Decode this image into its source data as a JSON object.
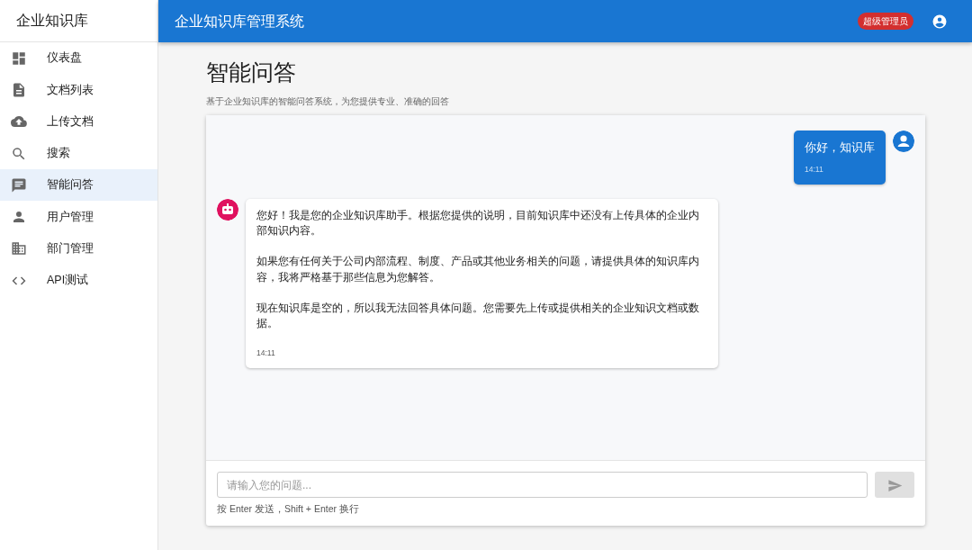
{
  "sidebar": {
    "title": "企业知识库",
    "items": [
      {
        "label": "仪表盘",
        "kind": "dashboard",
        "selected": false
      },
      {
        "label": "文档列表",
        "kind": "document",
        "selected": false
      },
      {
        "label": "上传文档",
        "kind": "upload",
        "selected": false
      },
      {
        "label": "搜索",
        "kind": "search",
        "selected": false
      },
      {
        "label": "智能问答",
        "kind": "chat",
        "selected": true
      },
      {
        "label": "用户管理",
        "kind": "person",
        "selected": false
      },
      {
        "label": "部门管理",
        "kind": "building",
        "selected": false
      },
      {
        "label": "API测试",
        "kind": "code",
        "selected": false
      }
    ]
  },
  "header": {
    "title": "企业知识库管理系统",
    "role_badge": "超级管理员"
  },
  "page": {
    "title": "智能问答",
    "subtitle": "基于企业知识库的智能问答系统，为您提供专业、准确的回答"
  },
  "messages": [
    {
      "kind": "user",
      "paragraphs": [
        "你好，知识库"
      ],
      "time": "14:11"
    },
    {
      "kind": "assistant",
      "paragraphs": [
        "您好！我是您的企业知识库助手。根据您提供的说明，目前知识库中还没有上传具体的企业内部知识内容。",
        "如果您有任何关于公司内部流程、制度、产品或其他业务相关的问题，请提供具体的知识库内容，我将严格基于那些信息为您解答。",
        "现在知识库是空的，所以我无法回答具体问题。您需要先上传或提供相关的企业知识文档或数据。"
      ],
      "time": "14:11"
    }
  ],
  "composer": {
    "placeholder": "请输入您的问题...",
    "send_disabled": true,
    "hint": "按 Enter 发送，Shift + Enter 换行"
  }
}
